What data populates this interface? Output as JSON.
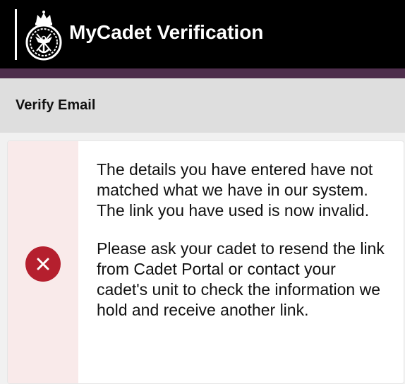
{
  "header": {
    "title": "MyCadet Verification",
    "logo_icon": "mod-crest-icon"
  },
  "subheader": {
    "title": "Verify Email"
  },
  "alert": {
    "icon": "error-x-icon",
    "messages": [
      "The details you have entered have not matched what we have in our system. The link you have used is now invalid.",
      "Please ask your cadet to resend the link from Cadet Portal or contact your cadet's unit to check the information we hold and receive another link."
    ]
  },
  "colors": {
    "header_bg": "#000000",
    "accent_band": "#4d2d4b",
    "subheader_bg": "#dedede",
    "alert_stripe": "#f9eaea",
    "error": "#b51f2e"
  }
}
